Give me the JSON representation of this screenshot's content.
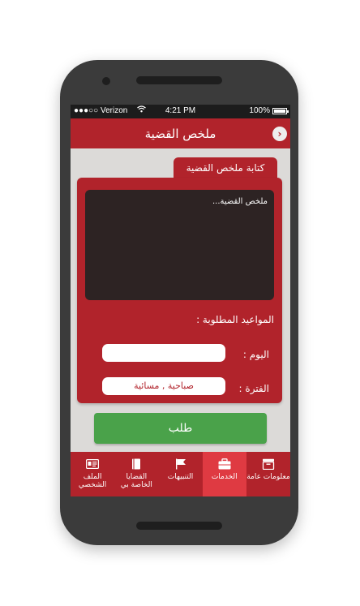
{
  "status_bar": {
    "carrier": "●●●○○ Verizon",
    "time": "4:21 PM",
    "battery": "100%"
  },
  "header": {
    "title": "ملخص القضية",
    "back_icon": "chevron-right-icon"
  },
  "section_tab": {
    "label": "كتابة ملخص القضية"
  },
  "form": {
    "summary_placeholder": "ملخص القضية...",
    "appointments_label": "المواعيد المطلوبة :",
    "day_label": "اليوم :",
    "day_value": "",
    "period_label": "الفترة :",
    "period_value": "صباحية , مسائية"
  },
  "submit_label": "طلب",
  "tabbar": {
    "items": [
      {
        "label": "الملف الشخصي",
        "icon": "id-card-icon",
        "active": false
      },
      {
        "label": "القضايا الخاصة بي",
        "icon": "book-icon",
        "active": false
      },
      {
        "label": "التنبيهات",
        "icon": "flag-icon",
        "active": false
      },
      {
        "label": "الخدمات",
        "icon": "briefcase-icon",
        "active": true
      },
      {
        "label": "معلومات عامة",
        "icon": "inbox-icon",
        "active": false
      }
    ]
  },
  "colors": {
    "primary_red": "#b1232b",
    "active_tab": "#df3a42",
    "button_green": "#4aa24a",
    "textarea_dark": "#2d2323"
  }
}
